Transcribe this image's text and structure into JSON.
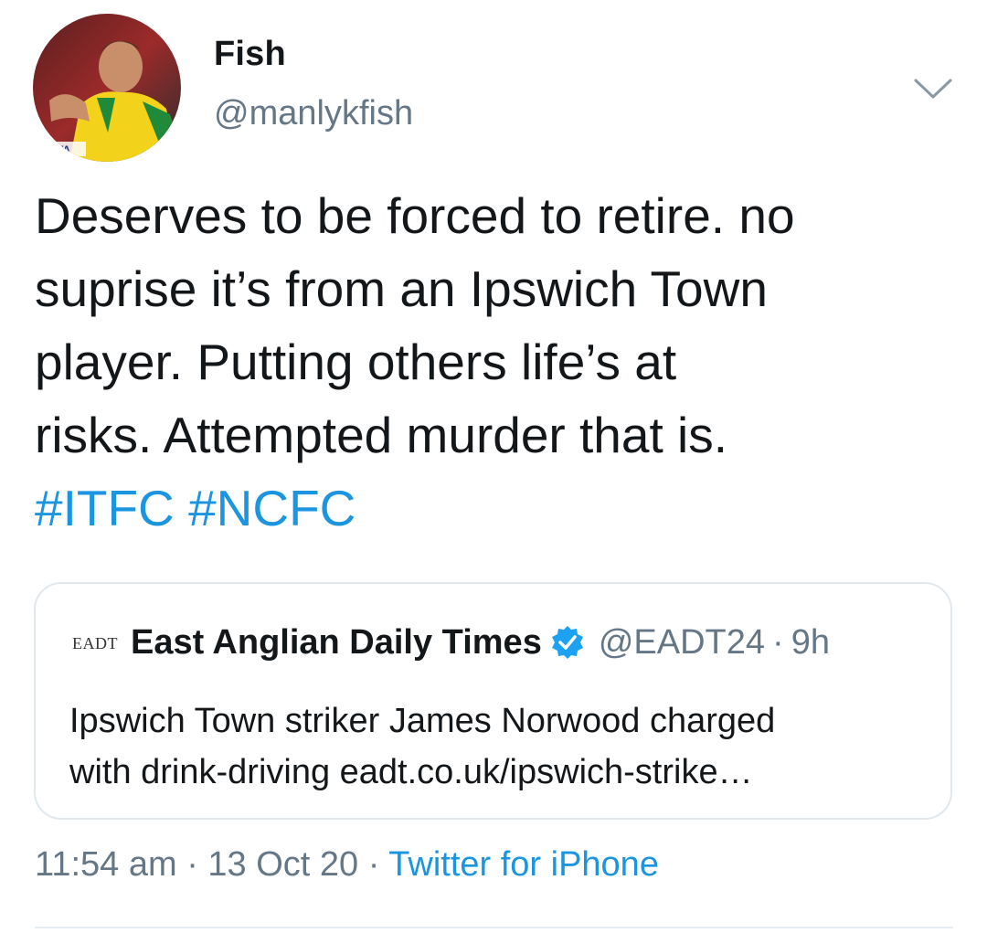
{
  "author": {
    "display_name": "Fish",
    "handle": "@manlykfish",
    "avatar_icon": "profile-photo"
  },
  "menu": {
    "icon": "chevron-down-icon"
  },
  "tweet": {
    "lines": [
      "Deserves to be forced to retire. no",
      "suprise it’s from an Ipswich Town",
      "player. Putting others life’s at",
      "risks. Attempted murder that is."
    ],
    "hashtags": [
      "#ITFC",
      "#NCFC"
    ]
  },
  "quoted_tweet": {
    "logo_text": "EADT",
    "name": "East Anglian Daily Times",
    "verified_icon": "verified-badge-icon",
    "handle": "@EADT24",
    "separator": "·",
    "time": "9h",
    "lines": [
      "Ipswich Town striker James Norwood charged",
      "with drink-driving eadt.co.uk/ipswich-strike…"
    ]
  },
  "meta": {
    "time": "11:54 am",
    "separator": "·",
    "date": "13 Oct 20",
    "source": "Twitter for iPhone"
  },
  "colors": {
    "link": "#1b95e0",
    "secondary_text": "#657786",
    "primary_text": "#14171a",
    "border": "#e1e8ed"
  }
}
